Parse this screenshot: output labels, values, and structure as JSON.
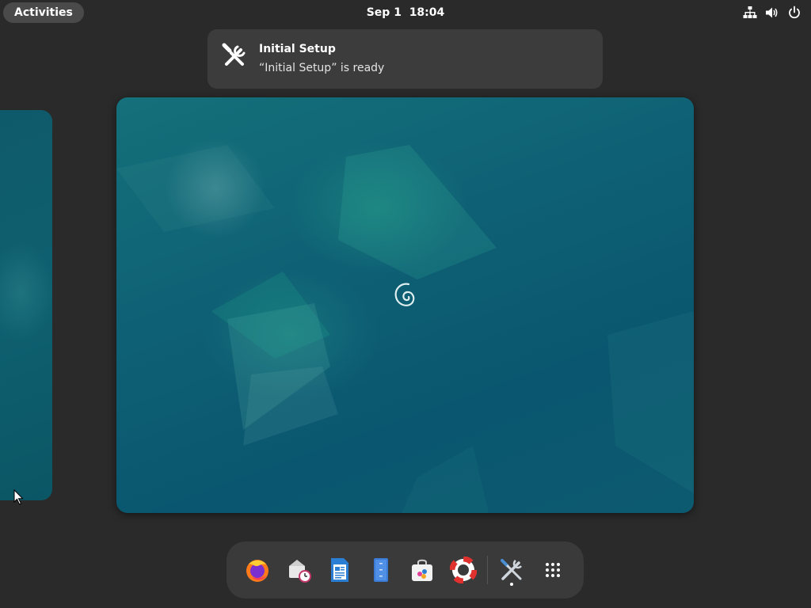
{
  "topbar": {
    "activities_label": "Activities",
    "date": "Sep 1",
    "time": "18:04",
    "tray_icons": [
      "network-icon",
      "volume-icon",
      "power-icon"
    ]
  },
  "notification": {
    "icon": "tools-icon",
    "title": "Initial Setup",
    "body": "“Initial Setup” is ready"
  },
  "workspaces": {
    "main": {
      "logo": "debian-swirl-icon"
    },
    "left": {}
  },
  "dash": {
    "apps": [
      {
        "name": "Firefox",
        "icon": "firefox-icon"
      },
      {
        "name": "Evolution",
        "icon": "mail-clock-icon"
      },
      {
        "name": "LibreOffice Writer",
        "icon": "writer-icon"
      },
      {
        "name": "Files",
        "icon": "files-icon"
      },
      {
        "name": "Software",
        "icon": "software-bag-icon"
      },
      {
        "name": "Help",
        "icon": "lifebuoy-icon"
      },
      {
        "name": "Initial Setup",
        "icon": "tools-icon",
        "running": true
      },
      {
        "name": "Show Apps",
        "icon": "app-grid-icon"
      }
    ]
  },
  "colors": {
    "panel": "#2a2a2a",
    "notification_bg": "#3c3c3c",
    "dash_bg": "#3a3a3a",
    "wallpaper": "#0e6074"
  }
}
